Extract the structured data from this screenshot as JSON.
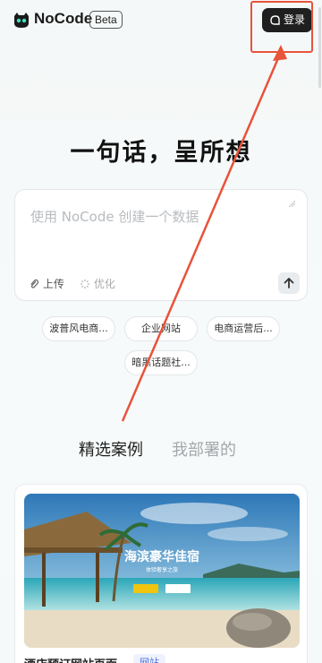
{
  "header": {
    "brand": "NoCode",
    "beta": "Beta",
    "login_label": "登录"
  },
  "hero": {
    "title": "一句话，呈所想"
  },
  "input": {
    "placeholder": "使用 NoCode 创建一个数据",
    "upload_label": "上传",
    "optimize_label": "优化"
  },
  "chips": [
    "波普风电商...",
    "企业网站",
    "电商运营后...",
    "暗黑话题社..."
  ],
  "tabs": {
    "featured": "精选案例",
    "mine": "我部署的"
  },
  "showcase": {
    "preview_title": "海滨豪华佳宿",
    "preview_sub": "体验奢享之旅",
    "title": "酒店预订网站页面",
    "badge": "网站"
  },
  "colors": {
    "annotation": "#e8533a",
    "login_bg": "#1f1f1f"
  }
}
